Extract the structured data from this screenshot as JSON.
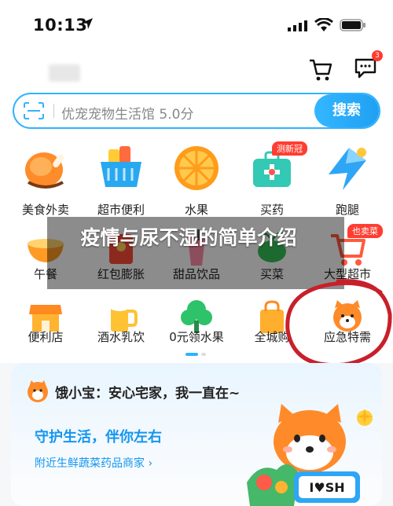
{
  "status_bar": {
    "time": "10:13"
  },
  "header": {
    "message_badge": "3"
  },
  "search": {
    "placeholder": "优宠宠物生活馆 5.0分",
    "button": "搜索"
  },
  "grid": {
    "row1": [
      {
        "label": "美食外卖",
        "icon": "chicken-leg-icon"
      },
      {
        "label": "超市便利",
        "icon": "basket-icon"
      },
      {
        "label": "水果",
        "icon": "orange-icon"
      },
      {
        "label": "买药",
        "icon": "medicine-box-icon",
        "tag": "测新冠"
      },
      {
        "label": "跑腿",
        "icon": "lightning-icon"
      }
    ],
    "row2": [
      {
        "label": "午餐",
        "icon": "lunch-icon"
      },
      {
        "label": "红包膨胀",
        "icon": "red-packet-icon"
      },
      {
        "label": "甜品饮品",
        "icon": "drink-icon"
      },
      {
        "label": "买菜",
        "icon": "vegetable-icon"
      },
      {
        "label": "大型超市",
        "icon": "cart-icon",
        "tag": "也卖菜"
      }
    ],
    "row3": [
      {
        "label": "便利店",
        "icon": "store-icon"
      },
      {
        "label": "酒水乳饮",
        "icon": "beer-icon"
      },
      {
        "label": "0元领水果",
        "icon": "tree-icon"
      },
      {
        "label": "全城购",
        "icon": "shopping-bag-icon"
      },
      {
        "label": "应急特需",
        "icon": "dog-face-icon"
      }
    ]
  },
  "overlay": {
    "title": "疫情与尿不湿的简单介绍"
  },
  "promo": {
    "headline": "饿小宝：安心宅家，我一直在~",
    "tagline": "守护生活，伴你左右",
    "subline": "附近生鲜蔬菜药品商家 ›",
    "sign": "I♥SH"
  },
  "colors": {
    "accent": "#2fb3ff",
    "tag_red": "#ff3d31",
    "ring": "#c8202b"
  }
}
